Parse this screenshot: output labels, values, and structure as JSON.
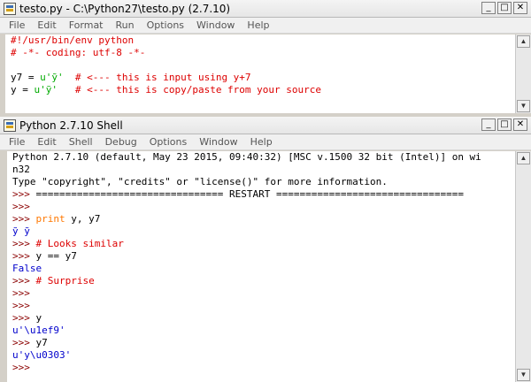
{
  "colors": {
    "comment": "#dd0000",
    "string": "#00aa00",
    "keyword": "#ff7700",
    "stdout": "#0000cc",
    "prompt": "#8b0000",
    "text": "#000000"
  },
  "editor": {
    "title": "testo.py - C:\\Python27\\testo.py (2.7.10)",
    "menu": [
      "File",
      "Edit",
      "Format",
      "Run",
      "Options",
      "Window",
      "Help"
    ],
    "lines": [
      [
        {
          "text": "#!/usr/bin/env python",
          "cls": "c-red"
        }
      ],
      [
        {
          "text": "# -*- coding: utf-8 -*-",
          "cls": "c-red"
        }
      ],
      [
        {
          "text": "",
          "cls": "c-black"
        }
      ],
      [
        {
          "text": "y7 = ",
          "cls": "c-black"
        },
        {
          "text": "u'ỹ'",
          "cls": "c-green"
        },
        {
          "text": "  ",
          "cls": "c-black"
        },
        {
          "text": "# <--- this is input using y+7",
          "cls": "c-red"
        }
      ],
      [
        {
          "text": "y = ",
          "cls": "c-black"
        },
        {
          "text": "u'ỹ'",
          "cls": "c-green"
        },
        {
          "text": "   ",
          "cls": "c-black"
        },
        {
          "text": "# <--- this is copy/paste from your source",
          "cls": "c-red"
        }
      ]
    ]
  },
  "shell": {
    "title": "Python 2.7.10 Shell",
    "menu": [
      "File",
      "Edit",
      "Shell",
      "Debug",
      "Options",
      "Window",
      "Help"
    ],
    "lines": [
      [
        {
          "text": "Python 2.7.10 (default, May 23 2015, 09:40:32) [MSC v.1500 32 bit (Intel)] on wi",
          "cls": "c-black"
        }
      ],
      [
        {
          "text": "n32",
          "cls": "c-black"
        }
      ],
      [
        {
          "text": "Type \"copyright\", \"credits\" or \"license()\" for more information.",
          "cls": "c-black"
        }
      ],
      [
        {
          "text": ">>> ",
          "cls": "c-maroon"
        },
        {
          "text": "================================ RESTART ================================",
          "cls": "c-black"
        }
      ],
      [
        {
          "text": ">>> ",
          "cls": "c-maroon"
        }
      ],
      [
        {
          "text": ">>> ",
          "cls": "c-maroon"
        },
        {
          "text": "print",
          "cls": "c-orange"
        },
        {
          "text": " y, y7",
          "cls": "c-black"
        }
      ],
      [
        {
          "text": "ỹ ỹ",
          "cls": "c-blue"
        }
      ],
      [
        {
          "text": ">>> ",
          "cls": "c-maroon"
        },
        {
          "text": "# Looks similar",
          "cls": "c-red"
        }
      ],
      [
        {
          "text": ">>> ",
          "cls": "c-maroon"
        },
        {
          "text": "y == y7",
          "cls": "c-black"
        }
      ],
      [
        {
          "text": "False",
          "cls": "c-blue"
        }
      ],
      [
        {
          "text": ">>> ",
          "cls": "c-maroon"
        },
        {
          "text": "# Surprise",
          "cls": "c-red"
        }
      ],
      [
        {
          "text": ">>> ",
          "cls": "c-maroon"
        }
      ],
      [
        {
          "text": ">>> ",
          "cls": "c-maroon"
        }
      ],
      [
        {
          "text": ">>> ",
          "cls": "c-maroon"
        },
        {
          "text": "y",
          "cls": "c-black"
        }
      ],
      [
        {
          "text": "u'\\u1ef9'",
          "cls": "c-blue"
        }
      ],
      [
        {
          "text": ">>> ",
          "cls": "c-maroon"
        },
        {
          "text": "y7",
          "cls": "c-black"
        }
      ],
      [
        {
          "text": "u'y\\u0303'",
          "cls": "c-blue"
        }
      ],
      [
        {
          "text": ">>> ",
          "cls": "c-maroon"
        }
      ]
    ]
  },
  "window_buttons": {
    "minimize": "_",
    "maximize": "□",
    "close": "✕"
  }
}
